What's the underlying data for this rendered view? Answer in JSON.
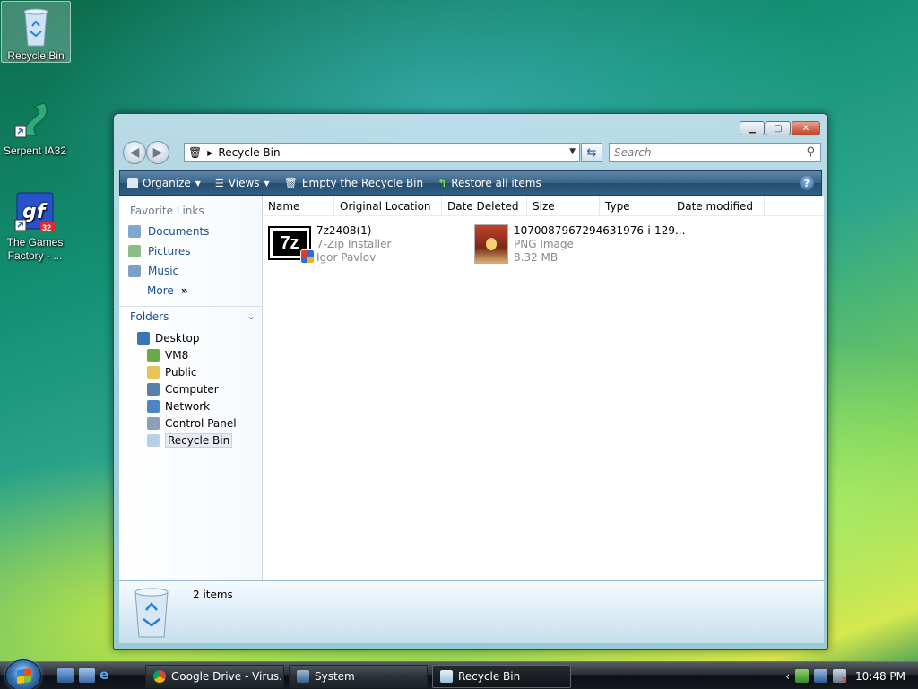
{
  "desktop": {
    "icons": [
      {
        "label": "Recycle Bin",
        "icon": "recycle-bin-icon"
      },
      {
        "label": "Serpent IA32",
        "icon": "serpent-icon"
      },
      {
        "label": "The Games Factory - ...",
        "icon": "games-factory-icon",
        "badge": "32"
      }
    ]
  },
  "window": {
    "address": "Recycle Bin",
    "search_placeholder": "Search",
    "toolbar": {
      "organize": "Organize",
      "views": "Views",
      "empty": "Empty the Recycle Bin",
      "restore": "Restore all items"
    },
    "nav": {
      "favorite_links_title": "Favorite Links",
      "favorites": [
        "Documents",
        "Pictures",
        "Music"
      ],
      "more": "More",
      "folders_title": "Folders",
      "tree": [
        "Desktop",
        "VM8",
        "Public",
        "Computer",
        "Network",
        "Control Panel",
        "Recycle Bin"
      ],
      "selected": "Recycle Bin"
    },
    "columns": [
      "Name",
      "Original Location",
      "Date Deleted",
      "Size",
      "Type",
      "Date modified"
    ],
    "files": [
      {
        "name": "7z2408(1)",
        "line2": "7-Zip Installer",
        "line3": "Igor Pavlov",
        "icon": "7zip-installer-icon"
      },
      {
        "name": "1070087967294631976-i-129...",
        "line2": "PNG Image",
        "line3": "8.32 MB",
        "icon": "png-image-icon"
      }
    ],
    "details": {
      "count": "2 items"
    }
  },
  "taskbar": {
    "buttons": [
      {
        "label": "Google Drive - Virus...",
        "icon": "chrome-icon"
      },
      {
        "label": "System",
        "icon": "system-icon"
      },
      {
        "label": "Recycle Bin",
        "icon": "recycle-bin-icon"
      }
    ],
    "clock": "10:48 PM"
  },
  "colors": {
    "accent": "#2f5f86",
    "link": "#1e4f95"
  }
}
